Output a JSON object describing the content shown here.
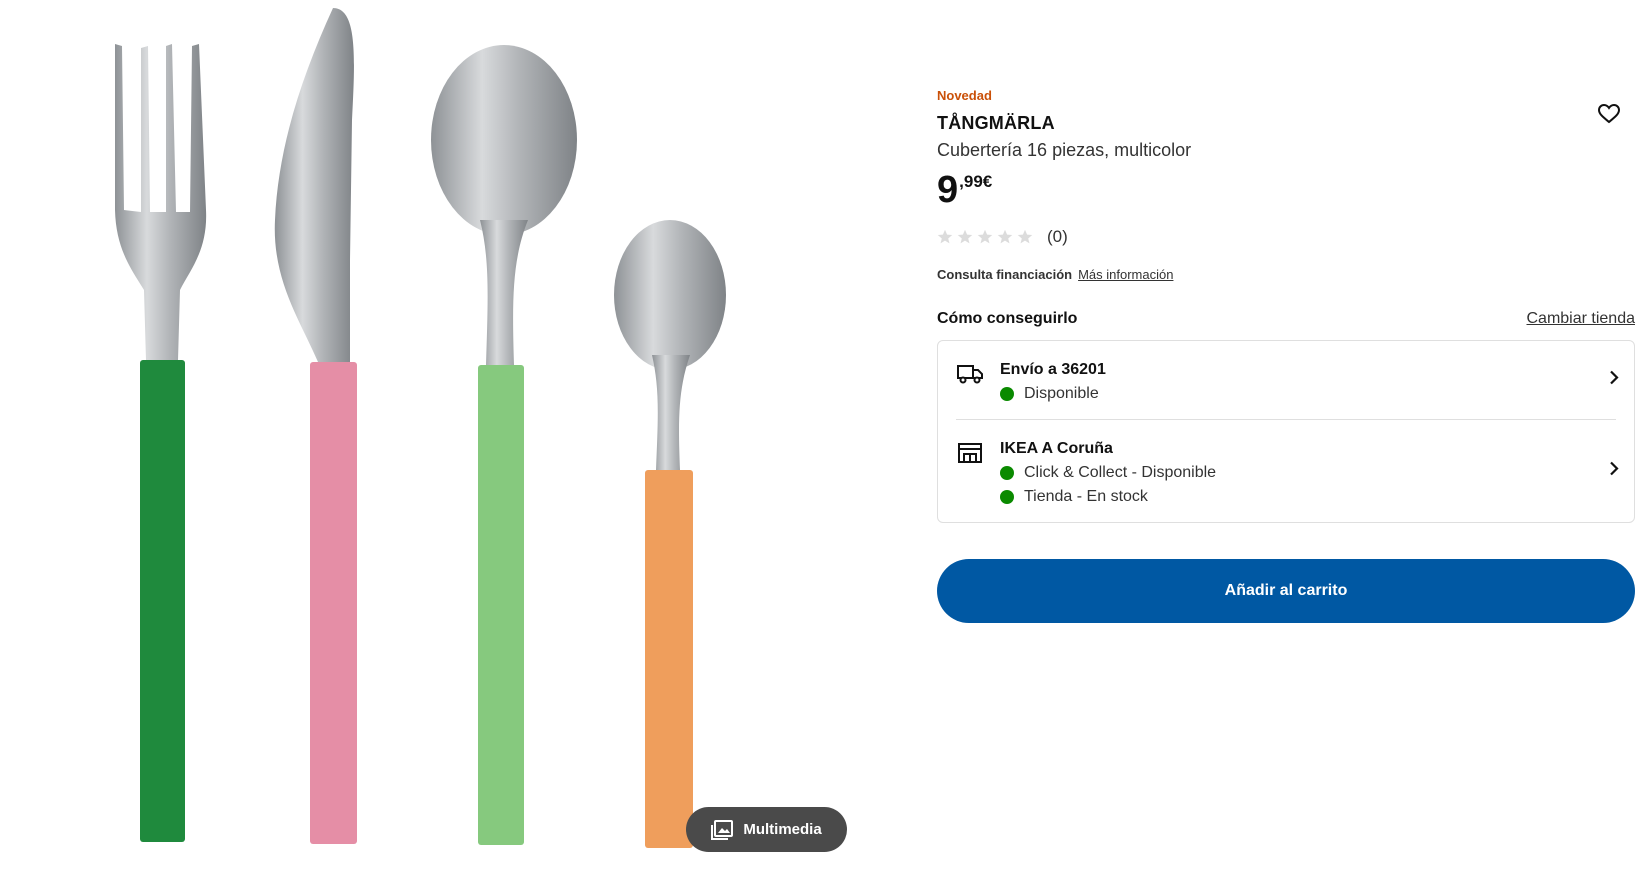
{
  "product": {
    "badge": "Novedad",
    "name": "TÅNGMÄRLA",
    "description": "Cubertería 16 piezas, multicolor",
    "price_integer": "9",
    "price_decimal": ",99€",
    "rating_stars": 0,
    "rating_count": "(0)"
  },
  "gallery": {
    "media_button_label": "Multimedia",
    "handle_colors": [
      "#1f8a3d",
      "#e58ea6",
      "#86c97e",
      "#ef9e5c"
    ]
  },
  "financing": {
    "label": "Consulta financiación",
    "link": "Más información"
  },
  "fulfillment": {
    "heading": "Cómo conseguirlo",
    "change_store": "Cambiar tienda",
    "delivery": {
      "title": "Envío a 36201",
      "status": "Disponible"
    },
    "store": {
      "title": "IKEA A Coruña",
      "status_collect": "Click & Collect - Disponible",
      "status_stock": "Tienda - En stock"
    }
  },
  "actions": {
    "add_to_cart": "Añadir al carrito"
  },
  "colors": {
    "badge": "#ca5008",
    "available": "#0a8a00",
    "primary": "#0058a3"
  },
  "icons": [
    "wishlist-heart-icon",
    "star-icon",
    "truck-icon",
    "store-icon",
    "chevron-right-icon",
    "gallery-icon"
  ]
}
